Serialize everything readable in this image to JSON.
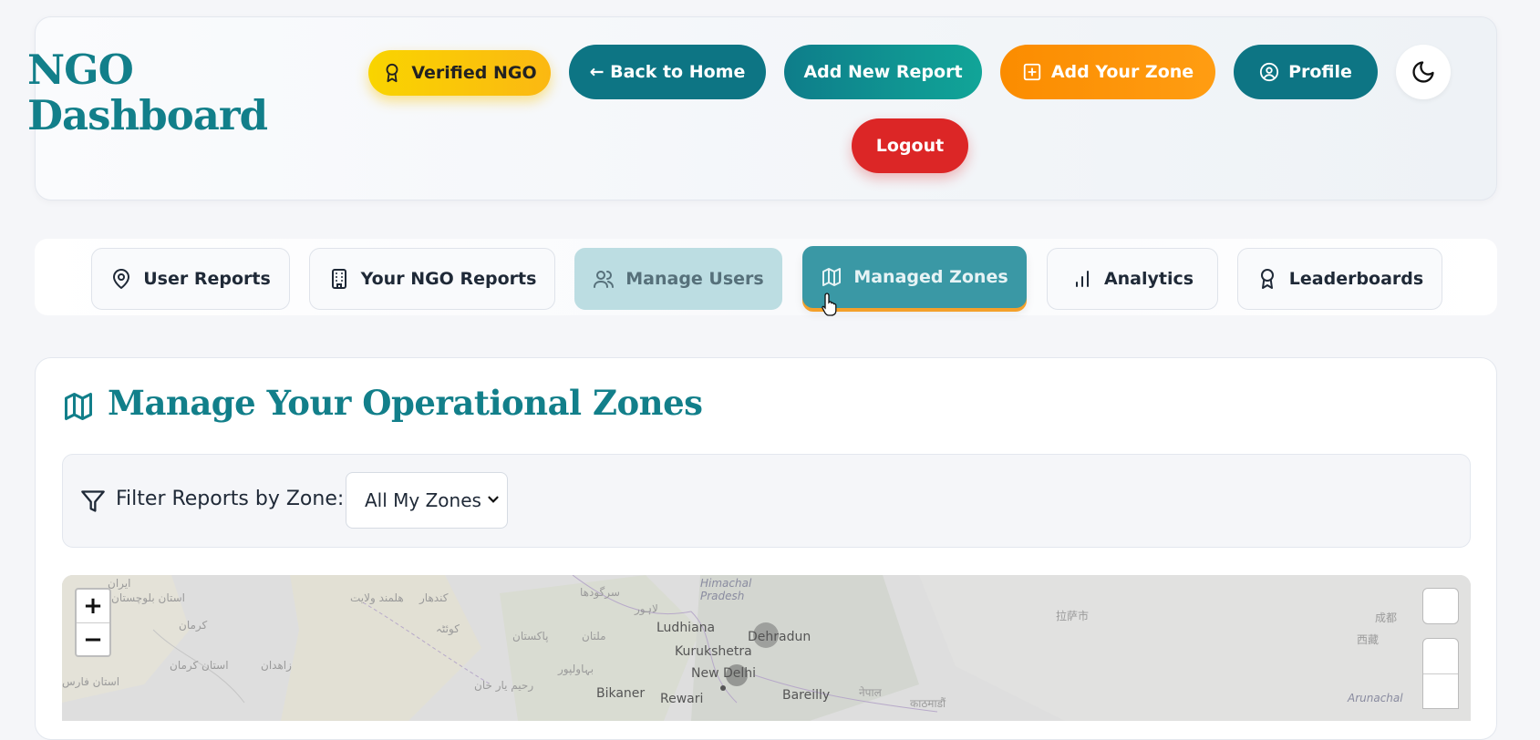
{
  "header": {
    "title": "NGO Dashboard",
    "verified_badge": "Verified NGO",
    "back_home": "← Back to Home",
    "add_report": "Add New Report",
    "add_zone": "Add Your Zone",
    "profile": "Profile",
    "logout": "Logout"
  },
  "tabs": [
    {
      "label": "User Reports",
      "icon": "map-pin-icon"
    },
    {
      "label": "Your NGO Reports",
      "icon": "building-icon"
    },
    {
      "label": "Manage Users",
      "icon": "users-icon"
    },
    {
      "label": "Managed Zones",
      "icon": "map-icon",
      "active": true
    },
    {
      "label": "Analytics",
      "icon": "bar-chart-icon"
    },
    {
      "label": "Leaderboards",
      "icon": "award-icon"
    }
  ],
  "main": {
    "title": "Manage Your Operational Zones",
    "filter_label": "Filter Reports by Zone:",
    "filter_value": "All My Zones"
  },
  "map": {
    "zoom_in": "+",
    "zoom_out": "−",
    "labels": [
      "Ludhiana",
      "Dehradun",
      "Kurukshetra",
      "New Delhi",
      "Bikaner",
      "Rewari",
      "Bareilly",
      "Himachal Pradesh",
      "Arunachal",
      "ایران",
      "استان بلوچستان",
      "کرمان",
      "زاهدان",
      "کوئٹہ",
      "ملتان",
      "پاکستان",
      "سرگودھا",
      "لاہور",
      "بہاولپور",
      "رحیم یار خان",
      "هلمند ولایت",
      "کندهار",
      "استان کرمان",
      "استان فارس",
      "नेपाल",
      "काठमाडौं",
      "拉萨市",
      "成都",
      "西藏"
    ]
  },
  "colors": {
    "brand_teal": "#127f8a",
    "orange": "#fb8c00",
    "red": "#dc2626",
    "gold": "#f9d400"
  }
}
